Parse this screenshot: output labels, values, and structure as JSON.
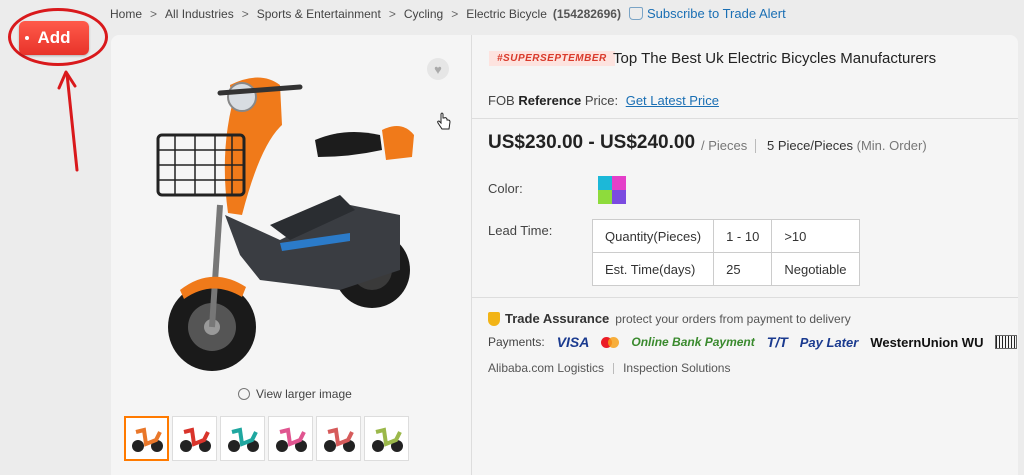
{
  "breadcrumb": {
    "items": [
      "Home",
      "All Industries",
      "Sports & Entertainment",
      "Cycling",
      "Electric Bicycle"
    ],
    "separator": ">",
    "product_id": "(154282696)",
    "subscribe_label": "Subscribe to Trade Alert"
  },
  "add_button": {
    "label": "Add"
  },
  "gallery": {
    "view_larger_label": "View larger image",
    "thumbnail_colors": [
      "#e9772a",
      "#d9342b",
      "#1fa7a0",
      "#e05590",
      "#d65b5b",
      "#9bb84a"
    ]
  },
  "product": {
    "promo_tag": "#SUPERSEPTEMBER",
    "title": "Top The Best Uk Electric Bicycles Manufacturers",
    "fob_prefix": "FOB",
    "fob_bold": "Reference",
    "fob_suffix": "Price:",
    "fob_link": "Get Latest Price",
    "price_range": "US$230.00 - US$240.00",
    "price_unit": "/ Pieces",
    "moq": "5 Piece/Pieces",
    "moq_note": "(Min. Order)",
    "color_label": "Color:",
    "lead_time_label": "Lead Time:",
    "lead_table": [
      [
        "Quantity(Pieces)",
        "1 - 10",
        ">10"
      ],
      [
        "Est. Time(days)",
        "25",
        "Negotiable"
      ]
    ]
  },
  "trade_assurance": {
    "title": "Trade Assurance",
    "description": "protect your orders from payment to delivery"
  },
  "payments": {
    "label": "Payments:",
    "methods": [
      "VISA",
      "Online Bank Payment",
      "T/T",
      "Pay Later",
      "WesternUnion WU"
    ]
  },
  "services": [
    "Alibaba.com Logistics",
    "Inspection Solutions"
  ],
  "colors": {
    "accent": "#ff7a00",
    "link": "#1a6fb4",
    "annotation": "#d9191c"
  }
}
